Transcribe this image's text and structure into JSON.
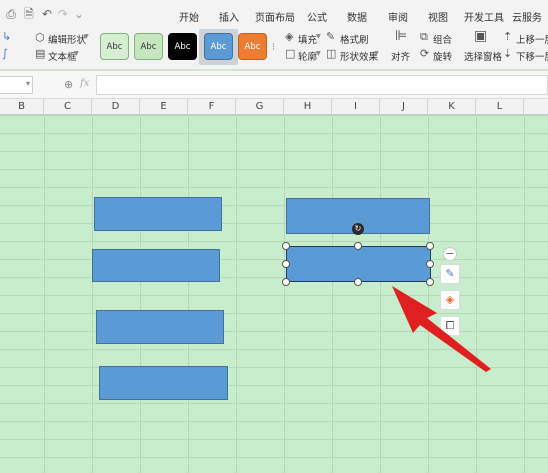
{
  "tabs": [
    "开始",
    "插入",
    "页面布局",
    "公式",
    "数据",
    "审阅",
    "视图",
    "开发工具",
    "云服务"
  ],
  "ribbon": {
    "edit_shape": "编辑形状",
    "text_box": "文本框",
    "style_label": "Abc",
    "fill": "填充",
    "format_brush": "格式刷",
    "outline": "轮廓",
    "shape_effects": "形状效果",
    "align": "对齐",
    "group": "组合",
    "rotate": "旋转",
    "selection_pane": "选择窗格",
    "bring_forward": "上移一层",
    "send_backward": "下移一层"
  },
  "formula_bar": {
    "fx": "fx",
    "value": ""
  },
  "columns": [
    "B",
    "C",
    "D",
    "E",
    "F",
    "G",
    "H",
    "I",
    "J",
    "K",
    "L"
  ],
  "colors": {
    "shape_fill": "#5b9bd5",
    "arrow": "#e02020",
    "sheet_bg": "#c7edcc"
  },
  "icons": [
    "print-icon",
    "preview-icon",
    "undo-icon",
    "redo-icon",
    "zoom-icon",
    "pen-icon",
    "fill-icon",
    "crop-icon",
    "rotate-handle-icon",
    "collapse-icon"
  ]
}
